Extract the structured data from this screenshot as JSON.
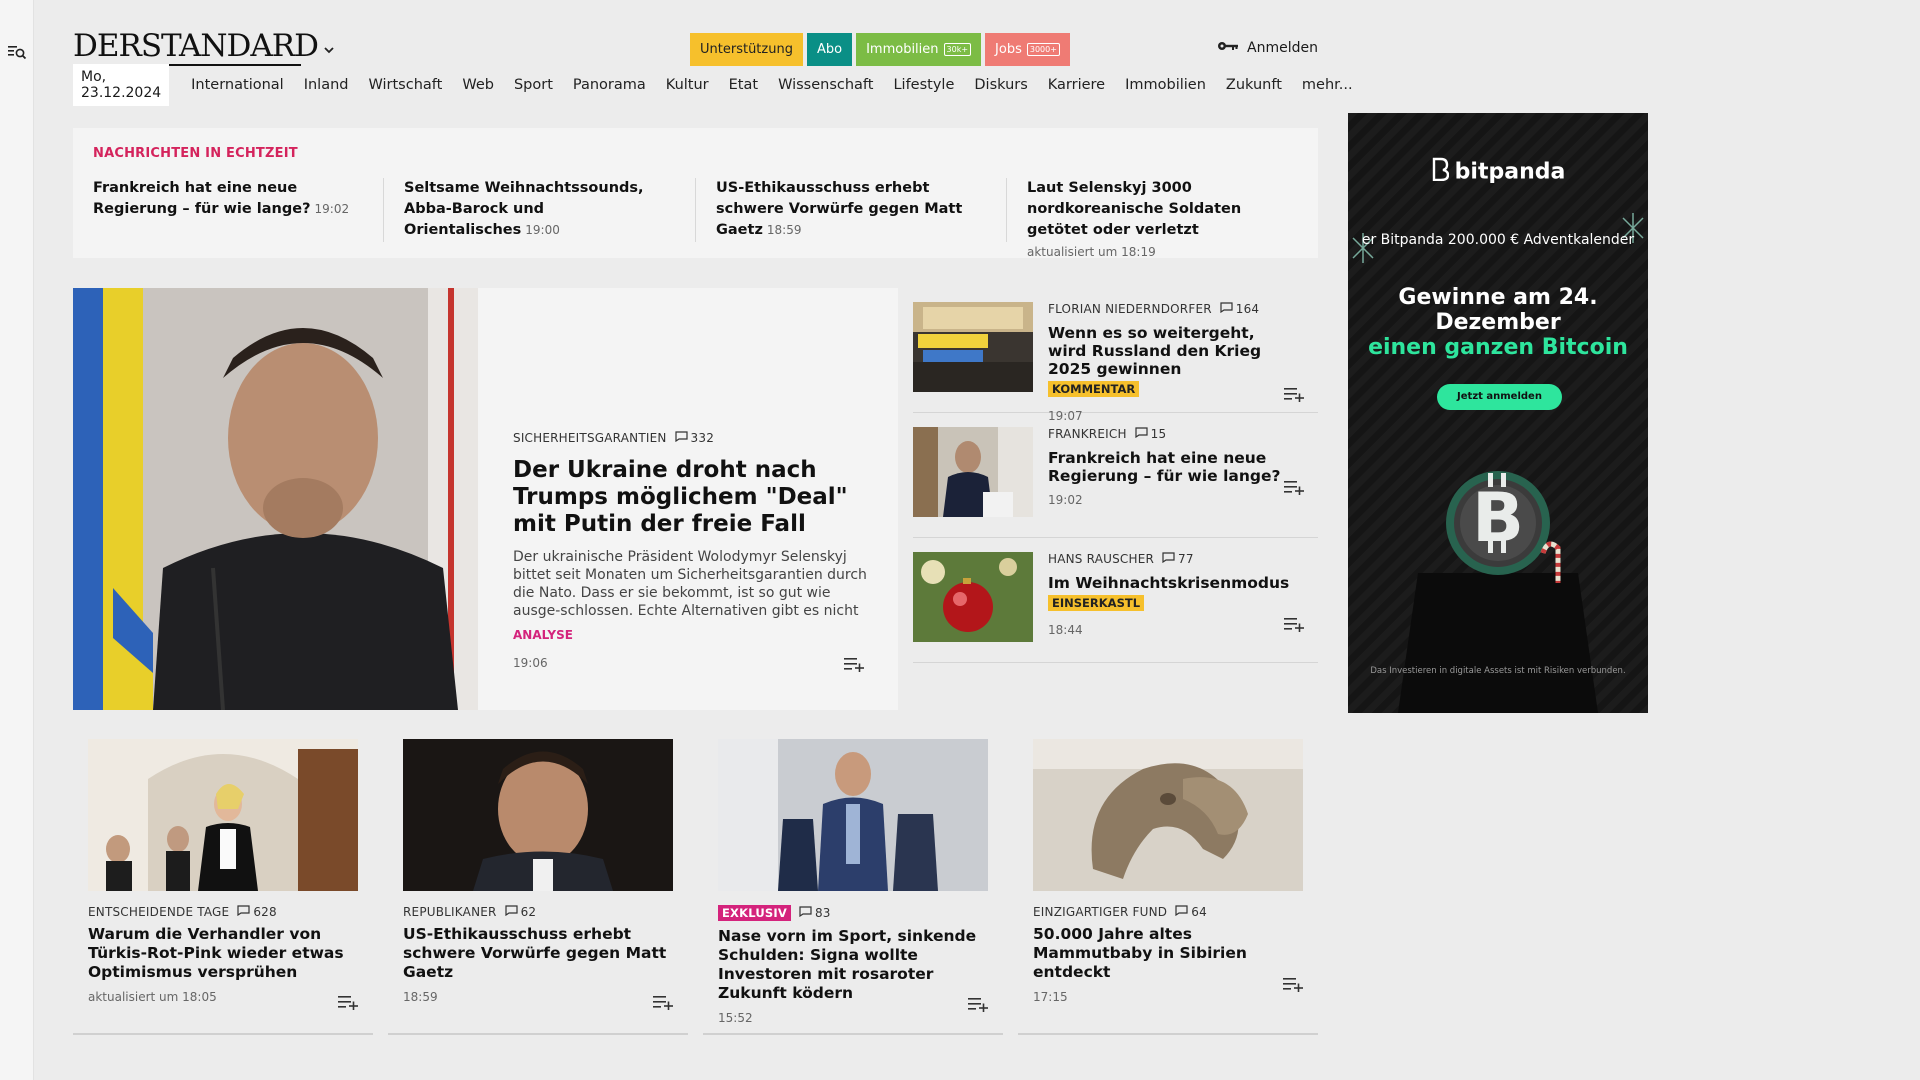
{
  "brand": {
    "logo": "DERSTANDARD"
  },
  "header": {
    "support_label": "Unterstützung",
    "abo_label": "Abo",
    "immo_label": "Immobilien",
    "immo_badge": "30k+",
    "jobs_label": "Jobs",
    "jobs_badge": "3000+",
    "login_label": "Anmelden"
  },
  "nav": {
    "date": "Mo, 23.12.2024",
    "items": [
      "International",
      "Inland",
      "Wirtschaft",
      "Web",
      "Sport",
      "Panorama",
      "Kultur",
      "Etat",
      "Wissenschaft",
      "Lifestyle",
      "Diskurs",
      "Karriere",
      "Immobilien",
      "Zukunft",
      "mehr..."
    ]
  },
  "ticker": {
    "label": "NACHRICHTEN IN ECHTZEIT",
    "items": [
      {
        "title": "Frankreich hat eine neue Regierung – für wie lange?",
        "time": "19:02"
      },
      {
        "title": "Seltsame Weihnachtssounds, Abba-Barock und Orientalisches",
        "time": "19:00"
      },
      {
        "title": "US-Ethikausschuss erhebt schwere Vorwürfe gegen Matt Gaetz",
        "time": "18:59"
      },
      {
        "title": "Laut Selenskyj 3000 nordkoreanische Soldaten getötet oder verletzt",
        "updated": "aktualisiert um 18:19"
      }
    ]
  },
  "lead": {
    "kicker": "SICHERHEITSGARANTIEN",
    "comments": "332",
    "title": "Der Ukraine droht nach Trumps möglichem \"Deal\" mit Putin der freie Fall",
    "teaser": "Der ukrainische Präsident Wolodymyr Selenskyj bittet seit Monaten um Sicherheitsgarantien durch die Nato. Dass er sie bekommt, ist so gut wie ausge-schlossen. Echte Alternativen gibt es nicht",
    "tag": "ANALYSE",
    "time": "19:06"
  },
  "side": [
    {
      "kicker": "FLORIAN NIEDERNDORFER",
      "comments": "164",
      "title": "Wenn es so weitergeht, wird Russland den Krieg 2025 gewinnen",
      "label": "KOMMENTAR",
      "time": "19:07"
    },
    {
      "kicker": "FRANKREICH",
      "comments": "15",
      "title": "Frankreich hat eine neue Regierung – für wie lange?",
      "label": "",
      "time": "19:02"
    },
    {
      "kicker": "HANS RAUSCHER",
      "comments": "77",
      "title": "Im Weihnachtskrisenmodus",
      "label": "EINSERKASTL",
      "time": "18:44"
    }
  ],
  "cards": [
    {
      "kicker": "ENTSCHEIDENDE TAGE",
      "comments": "628",
      "title": "Warum die Verhandler von Türkis-Rot-Pink wieder etwas Optimismus versprühen",
      "time": "aktualisiert um 18:05"
    },
    {
      "kicker": "REPUBLIKANER",
      "comments": "62",
      "title": "US-Ethikausschuss erhebt schwere Vorwürfe gegen Matt Gaetz",
      "time": "18:59"
    },
    {
      "kicker": "EXKLUSIV",
      "comments": "83",
      "title": "Nase vorn im Sport, sinkende Schulden: Signa wollte Investoren mit rosaroter Zukunft ködern",
      "time": "15:52"
    },
    {
      "kicker": "EINZIGARTIGER FUND",
      "comments": "64",
      "title": "50.000 Jahre altes Mammutbaby in Sibirien entdeckt",
      "time": "17:15"
    }
  ],
  "ad": {
    "brand": "bitpanda",
    "sub": "er Bitpanda 200.000 € Adventkalender",
    "head1": "Gewinne am 24.",
    "head2": "Dezember",
    "head3": "einen ganzen Bitcoin",
    "button": "Jetzt anmelden",
    "disclaimer": "Das Investieren in digitale Assets ist mit Risiken verbunden."
  },
  "colors": {
    "accent_pink": "#d4237c",
    "label_yellow": "#f6c02c",
    "abo_teal": "#0a8f86",
    "immo_green": "#7cbc45",
    "jobs_red": "#ef7b74",
    "ad_green": "#2ee59d"
  }
}
